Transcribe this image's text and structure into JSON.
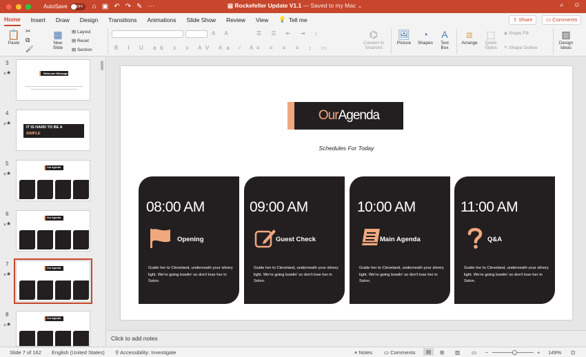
{
  "titlebar": {
    "autosave_label": "AutoSave",
    "autosave_state": "OFF",
    "doc_name": "Rockefeller Update V1.1",
    "doc_status": "— Saved to my Mac ⌄"
  },
  "tabs": [
    "Home",
    "Insert",
    "Draw",
    "Design",
    "Transitions",
    "Animations",
    "Slide Show",
    "Review",
    "View"
  ],
  "tell_me": "Tell me",
  "share_label": "Share",
  "comments_label": "Comments",
  "ribbon": {
    "paste": "Paste",
    "new_slide": "New Slide",
    "layout": "Layout",
    "reset": "Reset",
    "section": "Section",
    "convert_smartart": "Convert to SmartArt",
    "picture": "Picture",
    "shapes": "Shapes",
    "text_box": "Text Box",
    "arrange": "Arrange",
    "quick_styles": "Quick Styles",
    "shape_fill": "Shape Fill",
    "shape_outline": "Shape Outline",
    "design_ideas": "Design Ideas"
  },
  "thumbnails": [
    {
      "num": "3",
      "title": "Welcome Message"
    },
    {
      "num": "4",
      "title": "IT IS HARD TO BE A",
      "accent": "SIMPLE"
    },
    {
      "num": "5",
      "title": "Our Agenda"
    },
    {
      "num": "6",
      "title": "Our Agenda"
    },
    {
      "num": "7",
      "title": "Our Agenda"
    },
    {
      "num": "8",
      "title": "Our Agenda"
    }
  ],
  "slide": {
    "title_first": "Our",
    "title_rest": "Agenda",
    "subtitle": "Schedules For Today",
    "cards": [
      {
        "time": "08:00 AM",
        "label": "Opening",
        "desc": "Guide her to Cleveland, underneath your silvery light. We're going bowlin' so don't lose her in Solon."
      },
      {
        "time": "09:00 AM",
        "label": "Guest Check",
        "desc": "Guide her to Cleveland, underneath your silvery light. We're going bowlin' so don't lose her in Solon."
      },
      {
        "time": "10:00 AM",
        "label": "Main Agenda",
        "desc": "Guide her to Cleveland, underneath your silvery light. We're going bowlin' so don't lose her in Solon."
      },
      {
        "time": "11:00 AM",
        "label": "Q&A",
        "desc": "Guide her to Cleveland, underneath your silvery light. We're going bowlin' so don't lose her in Solon."
      }
    ]
  },
  "notes_placeholder": "Click to add notes",
  "statusbar": {
    "slide_info": "Slide 7 of 162",
    "language": "English (United States)",
    "accessibility": "Accessibility: Investigate",
    "notes": "Notes",
    "comments": "Comments",
    "zoom": "149%"
  },
  "colors": {
    "accent": "#c8462b",
    "peach": "#f1a87e",
    "dark": "#231f20"
  }
}
